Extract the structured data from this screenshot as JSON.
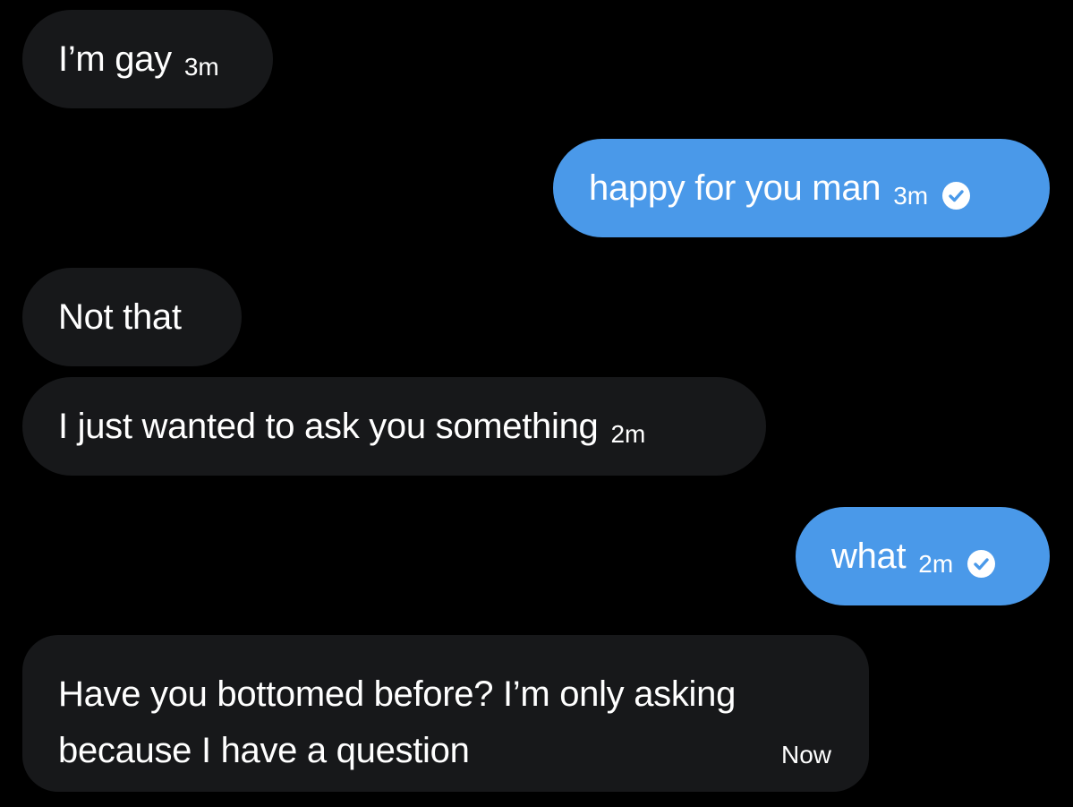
{
  "messages": [
    {
      "text": "I’m gay",
      "time": "3m"
    },
    {
      "text": "happy for you man",
      "time": "3m",
      "status_icon": "check-circle-icon"
    },
    {
      "text": "Not that"
    },
    {
      "text": "I just wanted to ask you something",
      "time": "2m"
    },
    {
      "text": "what",
      "time": "2m",
      "status_icon": "check-circle-icon"
    },
    {
      "line1": "Have you bottomed before? I’m only asking",
      "line2": "because I have a question",
      "time": "Now"
    }
  ],
  "colors": {
    "background": "#000000",
    "received_bubble": "#17181a",
    "sent_bubble": "#4a99e9",
    "text": "#ffffff"
  }
}
